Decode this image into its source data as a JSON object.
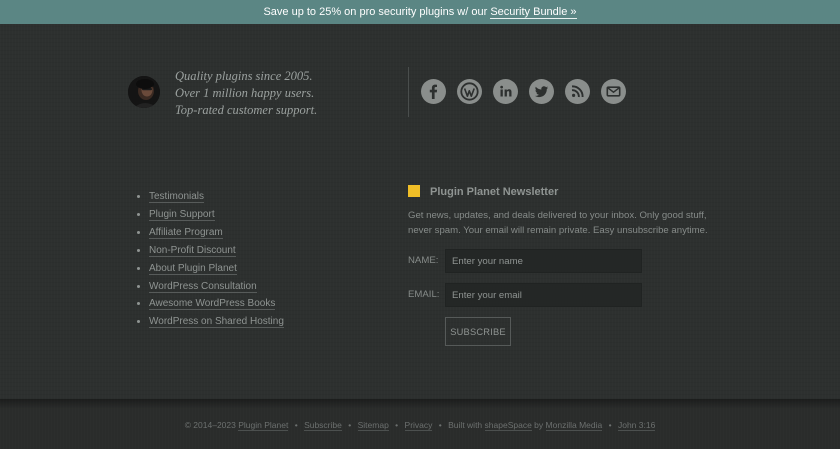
{
  "topbar": {
    "text": "Save up to 25% on pro security plugins w/ our",
    "link_label": "Security Bundle »"
  },
  "about": {
    "tagline": [
      "Quality plugins since 2005.",
      "Over 1 million happy users.",
      "Top-rated customer support."
    ]
  },
  "social_icons": [
    "facebook-icon",
    "wordpress-icon",
    "linkedin-icon",
    "twitter-icon",
    "rss-icon",
    "email-icon"
  ],
  "links": [
    "Testimonials",
    "Plugin Support",
    "Affiliate Program",
    "Non-Profit Discount",
    "About Plugin Planet",
    "WordPress Consultation",
    "Awesome WordPress Books",
    "WordPress on Shared Hosting"
  ],
  "newsletter": {
    "title": "Plugin Planet Newsletter",
    "description": "Get news, updates, and deals delivered to your inbox. Only good stuff, never spam. Your email will remain private. Easy unsubscribe anytime.",
    "name_label": "NAME:",
    "name_placeholder": "Enter your name",
    "email_label": "EMAIL:",
    "email_placeholder": "Enter your email",
    "button_label": "SUBSCRIBE"
  },
  "footer": {
    "copyright": "© 2014–2023",
    "site_link": "Plugin Planet",
    "subscribe_link": "Subscribe",
    "sitemap_link": "Sitemap",
    "privacy_link": "Privacy",
    "built_text": "Built with",
    "shapespace_link": "shapeSpace",
    "by_text": "by",
    "monzilla_link": "Monzilla Media",
    "verse_link": "John 3:16",
    "separator": "•"
  },
  "colors": {
    "topbar": "#5b8684",
    "background": "#2d302f",
    "accent": "#f0be27",
    "icon": "#8a8e8c"
  }
}
